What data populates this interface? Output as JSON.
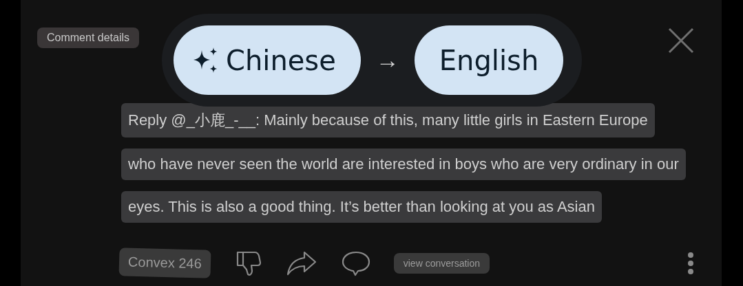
{
  "header": {
    "label": "Comment details"
  },
  "translation": {
    "source": "Chinese",
    "arrow": "→",
    "target": "English"
  },
  "comment": {
    "lines": [
      "Reply @_小鹿_-__: Mainly because of this, many little girls in Eastern Europe",
      "who have never seen the world are interested in boys who are very ordinary in our",
      "eyes. This is also a good thing. It’s better than looking at you as Asian"
    ]
  },
  "actions": {
    "vote": "Convex 246",
    "view": "view conversation"
  }
}
